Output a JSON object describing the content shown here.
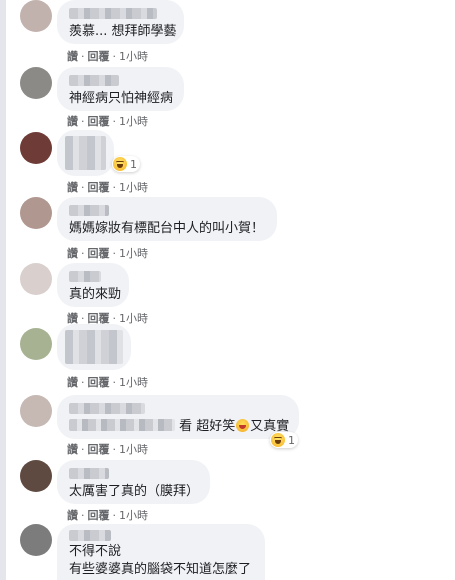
{
  "comments": [
    {
      "text": "羨慕... 想拜師學藝",
      "action_like": "讚",
      "action_reply": "回覆",
      "time": "1小時"
    },
    {
      "text": "神經病只怕神經病",
      "action_like": "讚",
      "action_reply": "回覆",
      "time": "1小時"
    },
    {
      "text": "",
      "reaction_count": "1",
      "action_like": "讚",
      "action_reply": "回覆",
      "time": "1小時"
    },
    {
      "text": "媽媽嫁妝有標配台中人的叫小賀！",
      "action_like": "讚",
      "action_reply": "回覆",
      "time": "1小時"
    },
    {
      "text": "真的來勁",
      "action_like": "讚",
      "action_reply": "回覆",
      "time": "1小時"
    },
    {
      "text": "",
      "action_like": "讚",
      "action_reply": "回覆",
      "time": "1小時"
    },
    {
      "text_a": "看 超好笑",
      "text_b": "又真實",
      "reaction_count": "1",
      "action_like": "讚",
      "action_reply": "回覆",
      "time": "1小時"
    },
    {
      "text": "太厲害了真的（膜拜）",
      "action_like": "讚",
      "action_reply": "回覆",
      "time": "1小時"
    },
    {
      "line1": "不得不說",
      "line2": "有些婆婆真的腦袋不知道怎麼了"
    }
  ],
  "sep": "·",
  "colors": {
    "bubble": "#f0f2f5",
    "meta": "#65676b",
    "text": "#1c1e21"
  },
  "icons": {
    "reaction": "haha-icon",
    "inline": "laughing-emoji-icon"
  }
}
